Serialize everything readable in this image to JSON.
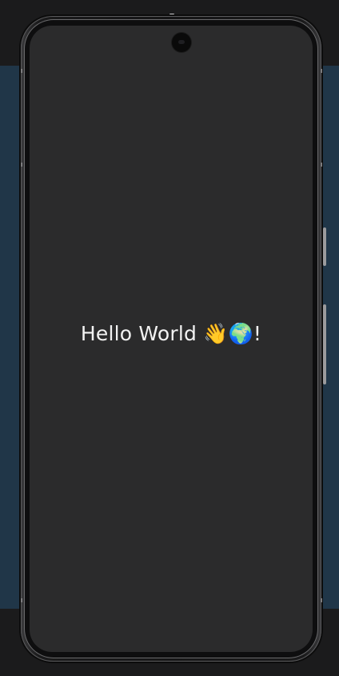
{
  "screen": {
    "greeting_text": "Hello World 👋🌍!",
    "background_color": "#2b2b2c",
    "text_color": "#f2f2f2"
  },
  "device": {
    "frame_color": "#151516",
    "backdrop_color": "#203648",
    "icons": [
      "front-camera-icon"
    ]
  }
}
